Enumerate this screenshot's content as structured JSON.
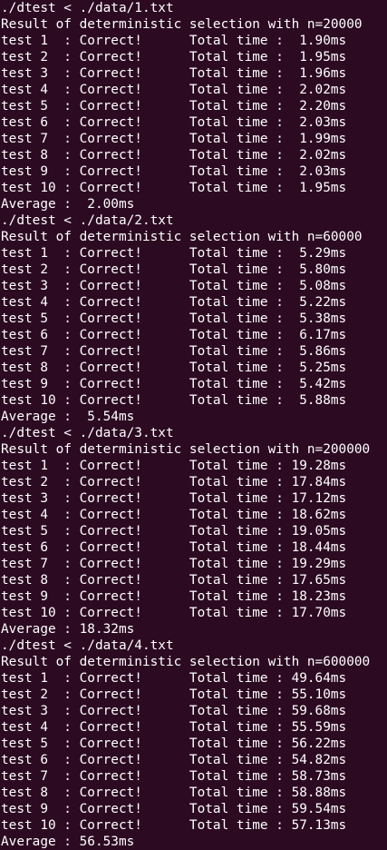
{
  "terminal": {
    "background": "#2c0a22",
    "foreground": "#ffffff",
    "blocks": [
      {
        "command": "./dtest < ./data/1.txt",
        "header": "Result of deterministic selection with n=20000",
        "tests": [
          "test 1  : Correct!      Total time :  1.90ms",
          "test 2  : Correct!      Total time :  1.95ms",
          "test 3  : Correct!      Total time :  1.96ms",
          "test 4  : Correct!      Total time :  2.02ms",
          "test 5  : Correct!      Total time :  2.20ms",
          "test 6  : Correct!      Total time :  2.03ms",
          "test 7  : Correct!      Total time :  1.99ms",
          "test 8  : Correct!      Total time :  2.02ms",
          "test 9  : Correct!      Total time :  2.03ms",
          "test 10 : Correct!      Total time :  1.95ms"
        ],
        "average": "Average :  2.00ms"
      },
      {
        "command": "./dtest < ./data/2.txt",
        "header": "Result of deterministic selection with n=60000",
        "tests": [
          "test 1  : Correct!      Total time :  5.29ms",
          "test 2  : Correct!      Total time :  5.80ms",
          "test 3  : Correct!      Total time :  5.08ms",
          "test 4  : Correct!      Total time :  5.22ms",
          "test 5  : Correct!      Total time :  5.38ms",
          "test 6  : Correct!      Total time :  6.17ms",
          "test 7  : Correct!      Total time :  5.86ms",
          "test 8  : Correct!      Total time :  5.25ms",
          "test 9  : Correct!      Total time :  5.42ms",
          "test 10 : Correct!      Total time :  5.88ms"
        ],
        "average": "Average :  5.54ms"
      },
      {
        "command": "./dtest < ./data/3.txt",
        "header": "Result of deterministic selection with n=200000",
        "tests": [
          "test 1  : Correct!      Total time : 19.28ms",
          "test 2  : Correct!      Total time : 17.84ms",
          "test 3  : Correct!      Total time : 17.12ms",
          "test 4  : Correct!      Total time : 18.62ms",
          "test 5  : Correct!      Total time : 19.05ms",
          "test 6  : Correct!      Total time : 18.44ms",
          "test 7  : Correct!      Total time : 19.29ms",
          "test 8  : Correct!      Total time : 17.65ms",
          "test 9  : Correct!      Total time : 18.23ms",
          "test 10 : Correct!      Total time : 17.70ms"
        ],
        "average": "Average : 18.32ms"
      },
      {
        "command": "./dtest < ./data/4.txt",
        "header": "Result of deterministic selection with n=600000",
        "tests": [
          "test 1  : Correct!      Total time : 49.64ms",
          "test 2  : Correct!      Total time : 55.10ms",
          "test 3  : Correct!      Total time : 59.68ms",
          "test 4  : Correct!      Total time : 55.59ms",
          "test 5  : Correct!      Total time : 56.22ms",
          "test 6  : Correct!      Total time : 54.82ms",
          "test 7  : Correct!      Total time : 58.73ms",
          "test 8  : Correct!      Total time : 58.88ms",
          "test 9  : Correct!      Total time : 59.54ms",
          "test 10 : Correct!      Total time : 57.13ms"
        ],
        "average": "Average : 56.53ms"
      }
    ]
  }
}
